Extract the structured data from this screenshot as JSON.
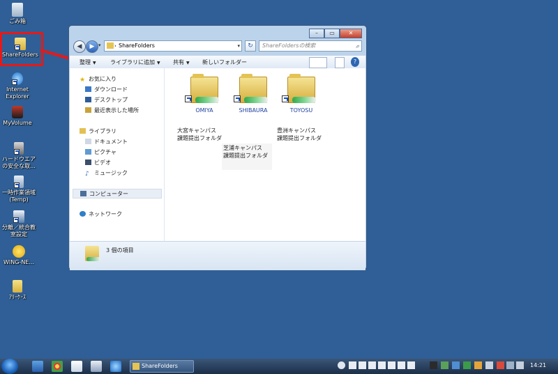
{
  "desktop": {
    "icons": [
      {
        "label": "ごみ箱",
        "icon": "recycle-bin-icon"
      },
      {
        "label": "ShareFolders",
        "icon": "share-folders-shortcut-icon"
      },
      {
        "label": "Internet Explorer",
        "icon": "internet-explorer-icon"
      },
      {
        "label": "MyVolume",
        "icon": "myvolume-icon"
      },
      {
        "label": "ハードウエアの安全な取...",
        "icon": "safely-remove-hardware-icon"
      },
      {
        "label": "一時作業領域(Temp)",
        "icon": "temp-workspace-icon"
      },
      {
        "label": "分離／統合教室設定",
        "icon": "classroom-settings-icon"
      },
      {
        "label": "WING-NE...",
        "icon": "wing-net-icon"
      },
      {
        "label": "ｱﾘｰｹｰｽ",
        "icon": "folder-icon"
      }
    ],
    "highlight_color": "#e41a1a"
  },
  "explorer": {
    "address_path": "ShareFolders",
    "search_placeholder": "ShareFoldersの検索",
    "toolbar": {
      "organize": "整理",
      "add_to_library": "ライブラリに追加",
      "share": "共有",
      "new_folder": "新しいフォルダー"
    },
    "nav": {
      "favorites": "お気に入り",
      "downloads": "ダウンロード",
      "desktop": "デスクトップ",
      "recent": "最近表示した場所",
      "libraries": "ライブラリ",
      "documents": "ドキュメント",
      "pictures": "ピクチャ",
      "videos": "ビデオ",
      "music": "ミュージック",
      "computer": "コンピューター",
      "network": "ネットワーク"
    },
    "items": [
      {
        "name": "OMIYA",
        "note_line1": "大宮キャンパス",
        "note_line2": "課題提出フォルダ"
      },
      {
        "name": "SHIBAURA",
        "note_line1": "芝浦キャンパス",
        "note_line2": "課題提出フォルダ"
      },
      {
        "name": "TOYOSU",
        "note_line1": "豊洲キャンパス",
        "note_line2": "課題提出フォルダ"
      }
    ],
    "status": "3 個の項目"
  },
  "taskbar": {
    "active_window": "ShareFolders",
    "clock": "14:21"
  }
}
